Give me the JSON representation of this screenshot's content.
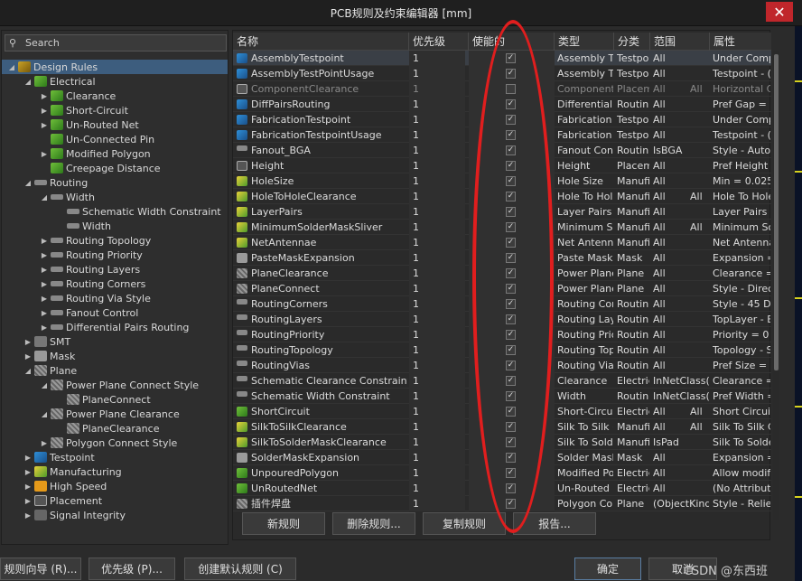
{
  "window": {
    "title": "PCB规则及约束编辑器 [mm]",
    "close_glyph": "✕"
  },
  "search": {
    "label": "Search"
  },
  "tree": [
    {
      "label": "Design Rules",
      "icon": "design-rules-icon",
      "arrow": "◢",
      "level": 0,
      "selected": true
    },
    {
      "label": "Electrical",
      "icon": "electrical-icon",
      "arrow": "◢",
      "level": 1
    },
    {
      "label": "Clearance",
      "icon": "clearance-icon",
      "arrow": "▶",
      "level": 2
    },
    {
      "label": "Short-Circuit",
      "icon": "short-circuit-icon",
      "arrow": "▶",
      "level": 2
    },
    {
      "label": "Un-Routed Net",
      "icon": "unrouted-net-icon",
      "arrow": "▶",
      "level": 2
    },
    {
      "label": "Un-Connected Pin",
      "icon": "unconnected-pin-icon",
      "arrow": "",
      "level": 2
    },
    {
      "label": "Modified Polygon",
      "icon": "modified-polygon-icon",
      "arrow": "▶",
      "level": 2
    },
    {
      "label": "Creepage Distance",
      "icon": "creepage-icon",
      "arrow": "",
      "level": 2
    },
    {
      "label": "Routing",
      "icon": "routing-icon",
      "arrow": "◢",
      "level": 1
    },
    {
      "label": "Width",
      "icon": "width-icon",
      "arrow": "◢",
      "level": 2
    },
    {
      "label": "Schematic Width Constraint",
      "icon": "width-rule-icon",
      "arrow": "",
      "level": 3
    },
    {
      "label": "Width",
      "icon": "width-rule-icon",
      "arrow": "",
      "level": 3
    },
    {
      "label": "Routing Topology",
      "icon": "routing-topology-icon",
      "arrow": "▶",
      "level": 2
    },
    {
      "label": "Routing Priority",
      "icon": "routing-priority-icon",
      "arrow": "▶",
      "level": 2
    },
    {
      "label": "Routing Layers",
      "icon": "routing-layers-icon",
      "arrow": "▶",
      "level": 2
    },
    {
      "label": "Routing Corners",
      "icon": "routing-corners-icon",
      "arrow": "▶",
      "level": 2
    },
    {
      "label": "Routing Via Style",
      "icon": "routing-via-icon",
      "arrow": "▶",
      "level": 2
    },
    {
      "label": "Fanout Control",
      "icon": "fanout-icon",
      "arrow": "▶",
      "level": 2
    },
    {
      "label": "Differential Pairs Routing",
      "icon": "diff-pairs-icon",
      "arrow": "▶",
      "level": 2
    },
    {
      "label": "SMT",
      "icon": "smt-icon",
      "arrow": "▶",
      "level": 1
    },
    {
      "label": "Mask",
      "icon": "mask-icon",
      "arrow": "▶",
      "level": 1
    },
    {
      "label": "Plane",
      "icon": "plane-icon",
      "arrow": "◢",
      "level": 1
    },
    {
      "label": "Power Plane Connect Style",
      "icon": "plane-icon",
      "arrow": "◢",
      "level": 2
    },
    {
      "label": "PlaneConnect",
      "icon": "plane-icon",
      "arrow": "",
      "level": 3
    },
    {
      "label": "Power Plane Clearance",
      "icon": "plane-icon",
      "arrow": "◢",
      "level": 2
    },
    {
      "label": "PlaneClearance",
      "icon": "plane-icon",
      "arrow": "",
      "level": 3
    },
    {
      "label": "Polygon Connect Style",
      "icon": "plane-icon",
      "arrow": "▶",
      "level": 2
    },
    {
      "label": "Testpoint",
      "icon": "testpoint-icon",
      "arrow": "▶",
      "level": 1
    },
    {
      "label": "Manufacturing",
      "icon": "manufacturing-icon",
      "arrow": "▶",
      "level": 1
    },
    {
      "label": "High Speed",
      "icon": "high-speed-icon",
      "arrow": "▶",
      "level": 1
    },
    {
      "label": "Placement",
      "icon": "placement-icon",
      "arrow": "▶",
      "level": 1
    },
    {
      "label": "Signal Integrity",
      "icon": "signal-integrity-icon",
      "arrow": "▶",
      "level": 1
    }
  ],
  "grid": {
    "headers": [
      "名称",
      "优先级",
      "使能的",
      "类型",
      "分类",
      "范围",
      "属性"
    ],
    "check_glyph": "✓",
    "rows": [
      {
        "name": "AssemblyTestpoint",
        "prio": "1",
        "checked": true,
        "type": "Assembly Te",
        "cat": "Testpo",
        "scope": "All",
        "scope2": "",
        "attr": "Under Comp",
        "icon": "testpoint-icon",
        "highlight": true
      },
      {
        "name": "AssemblyTestPointUsage",
        "prio": "1",
        "checked": true,
        "type": "Assembly Te",
        "cat": "Testpo",
        "scope": "All",
        "scope2": "",
        "attr": "Testpoint - (",
        "icon": "testpoint-icon"
      },
      {
        "name": "ComponentClearance",
        "prio": "1",
        "checked": false,
        "type": "Component",
        "cat": "Placem",
        "scope": "All",
        "scope2": "All",
        "attr": "Horizontal C",
        "icon": "placement-icon",
        "dim": true
      },
      {
        "name": "DiffPairsRouting",
        "prio": "1",
        "checked": true,
        "type": "Differential",
        "cat": "Routin",
        "scope": "All",
        "scope2": "",
        "attr": "Pref Gap = 0",
        "icon": "testpoint-icon"
      },
      {
        "name": "FabricationTestpoint",
        "prio": "1",
        "checked": true,
        "type": "Fabrication T",
        "cat": "Testpo",
        "scope": "All",
        "scope2": "",
        "attr": "Under Comp",
        "icon": "testpoint-icon"
      },
      {
        "name": "FabricationTestpointUsage",
        "prio": "1",
        "checked": true,
        "type": "Fabrication T",
        "cat": "Testpo",
        "scope": "All",
        "scope2": "",
        "attr": "Testpoint - (",
        "icon": "testpoint-icon"
      },
      {
        "name": "Fanout_BGA",
        "prio": "1",
        "checked": true,
        "type": "Fanout Con",
        "cat": "Routin",
        "scope": "IsBGA",
        "scope2": "",
        "attr": "Style - Auto",
        "icon": "routing-icon"
      },
      {
        "name": "Height",
        "prio": "1",
        "checked": true,
        "type": "Height",
        "cat": "Placem",
        "scope": "All",
        "scope2": "",
        "attr": "Pref Height =",
        "icon": "placement-icon"
      },
      {
        "name": "HoleSize",
        "prio": "1",
        "checked": true,
        "type": "Hole Size",
        "cat": "Manufi",
        "scope": "All",
        "scope2": "",
        "attr": "Min = 0.025n",
        "icon": "manufacturing-icon"
      },
      {
        "name": "HoleToHoleClearance",
        "prio": "1",
        "checked": true,
        "type": "Hole To Hol",
        "cat": "Manufi",
        "scope": "All",
        "scope2": "All",
        "attr": "Hole To Hole",
        "icon": "manufacturing-icon"
      },
      {
        "name": "LayerPairs",
        "prio": "1",
        "checked": true,
        "type": "Layer Pairs",
        "cat": "Manufi",
        "scope": "All",
        "scope2": "",
        "attr": "Layer Pairs -",
        "icon": "manufacturing-icon"
      },
      {
        "name": "MinimumSolderMaskSliver",
        "prio": "1",
        "checked": true,
        "type": "Minimum Sc",
        "cat": "Manufi",
        "scope": "All",
        "scope2": "All",
        "attr": "Minimum So",
        "icon": "manufacturing-icon"
      },
      {
        "name": "NetAntennae",
        "prio": "1",
        "checked": true,
        "type": "Net Antenna",
        "cat": "Manufi",
        "scope": "All",
        "scope2": "",
        "attr": "Net Antenna",
        "icon": "manufacturing-icon"
      },
      {
        "name": "PasteMaskExpansion",
        "prio": "1",
        "checked": true,
        "type": "Paste Mask I",
        "cat": "Mask",
        "scope": "All",
        "scope2": "",
        "attr": "Expansion =",
        "icon": "mask-icon"
      },
      {
        "name": "PlaneClearance",
        "prio": "1",
        "checked": true,
        "type": "Power Plane",
        "cat": "Plane",
        "scope": "All",
        "scope2": "",
        "attr": "Clearance =",
        "icon": "plane-icon"
      },
      {
        "name": "PlaneConnect",
        "prio": "1",
        "checked": true,
        "type": "Power Plane",
        "cat": "Plane",
        "scope": "All",
        "scope2": "",
        "attr": "Style - Direct",
        "icon": "plane-icon"
      },
      {
        "name": "RoutingCorners",
        "prio": "1",
        "checked": true,
        "type": "Routing Cor",
        "cat": "Routin",
        "scope": "All",
        "scope2": "",
        "attr": "Style - 45 De",
        "icon": "routing-icon"
      },
      {
        "name": "RoutingLayers",
        "prio": "1",
        "checked": true,
        "type": "Routing Lay",
        "cat": "Routin",
        "scope": "All",
        "scope2": "",
        "attr": "TopLayer - Ei",
        "icon": "routing-icon"
      },
      {
        "name": "RoutingPriority",
        "prio": "1",
        "checked": true,
        "type": "Routing Pric",
        "cat": "Routin",
        "scope": "All",
        "scope2": "",
        "attr": "Priority = 0",
        "icon": "routing-icon"
      },
      {
        "name": "RoutingTopology",
        "prio": "1",
        "checked": true,
        "type": "Routing Top",
        "cat": "Routin",
        "scope": "All",
        "scope2": "",
        "attr": "Topology - S",
        "icon": "routing-icon"
      },
      {
        "name": "RoutingVias",
        "prio": "1",
        "checked": true,
        "type": "Routing Via",
        "cat": "Routin",
        "scope": "All",
        "scope2": "",
        "attr": "Pref Size = 0",
        "icon": "routing-icon"
      },
      {
        "name": "Schematic Clearance Constraint",
        "prio": "1",
        "checked": true,
        "type": "Clearance",
        "cat": "Electric",
        "scope": "InNetClass(",
        "scope2": "",
        "attr": "Clearance =",
        "icon": "routing-icon"
      },
      {
        "name": "Schematic Width Constraint",
        "prio": "1",
        "checked": true,
        "type": "Width",
        "cat": "Routin",
        "scope": "InNetClass(",
        "scope2": "",
        "attr": "Pref Width =",
        "icon": "routing-icon"
      },
      {
        "name": "ShortCircuit",
        "prio": "1",
        "checked": true,
        "type": "Short-Circui",
        "cat": "Electric",
        "scope": "All",
        "scope2": "All",
        "attr": "Short Circuit",
        "icon": "electrical-icon"
      },
      {
        "name": "SilkToSilkClearance",
        "prio": "1",
        "checked": true,
        "type": "Silk To Silk (",
        "cat": "Manufi",
        "scope": "All",
        "scope2": "All",
        "attr": "Silk To Silk C",
        "icon": "manufacturing-icon"
      },
      {
        "name": "SilkToSolderMaskClearance",
        "prio": "1",
        "checked": true,
        "type": "Silk To Solde",
        "cat": "Manufi",
        "scope": "IsPad",
        "scope2": "",
        "attr": "Silk To Solde",
        "icon": "manufacturing-icon"
      },
      {
        "name": "SolderMaskExpansion",
        "prio": "1",
        "checked": true,
        "type": "Solder Mask",
        "cat": "Mask",
        "scope": "All",
        "scope2": "",
        "attr": "Expansion =",
        "icon": "mask-icon"
      },
      {
        "name": "UnpouredPolygon",
        "prio": "1",
        "checked": true,
        "type": "Modified Po",
        "cat": "Electric",
        "scope": "All",
        "scope2": "",
        "attr": "Allow modifi",
        "icon": "electrical-icon"
      },
      {
        "name": "UnRoutedNet",
        "prio": "1",
        "checked": true,
        "type": "Un-Routed I",
        "cat": "Electric",
        "scope": "All",
        "scope2": "",
        "attr": "(No Attribute",
        "icon": "electrical-icon"
      },
      {
        "name": "插件焊盘",
        "prio": "1",
        "checked": true,
        "type": "Polygon Cor",
        "cat": "Plane",
        "scope": "(ObjectKind",
        "scope2": "",
        "attr": "Style - Relief",
        "icon": "plane-icon"
      }
    ],
    "buttons": {
      "new": "新规则",
      "delete": "删除规则...",
      "copy": "复制规则",
      "report": "报告..."
    }
  },
  "footer": {
    "wizard": "规则向导 (R)...",
    "priority": "优先级 (P)...",
    "default": "创建默认规则 (C)",
    "ok": "确定",
    "cancel": "取消"
  },
  "watermark": "CSDN @东西班"
}
